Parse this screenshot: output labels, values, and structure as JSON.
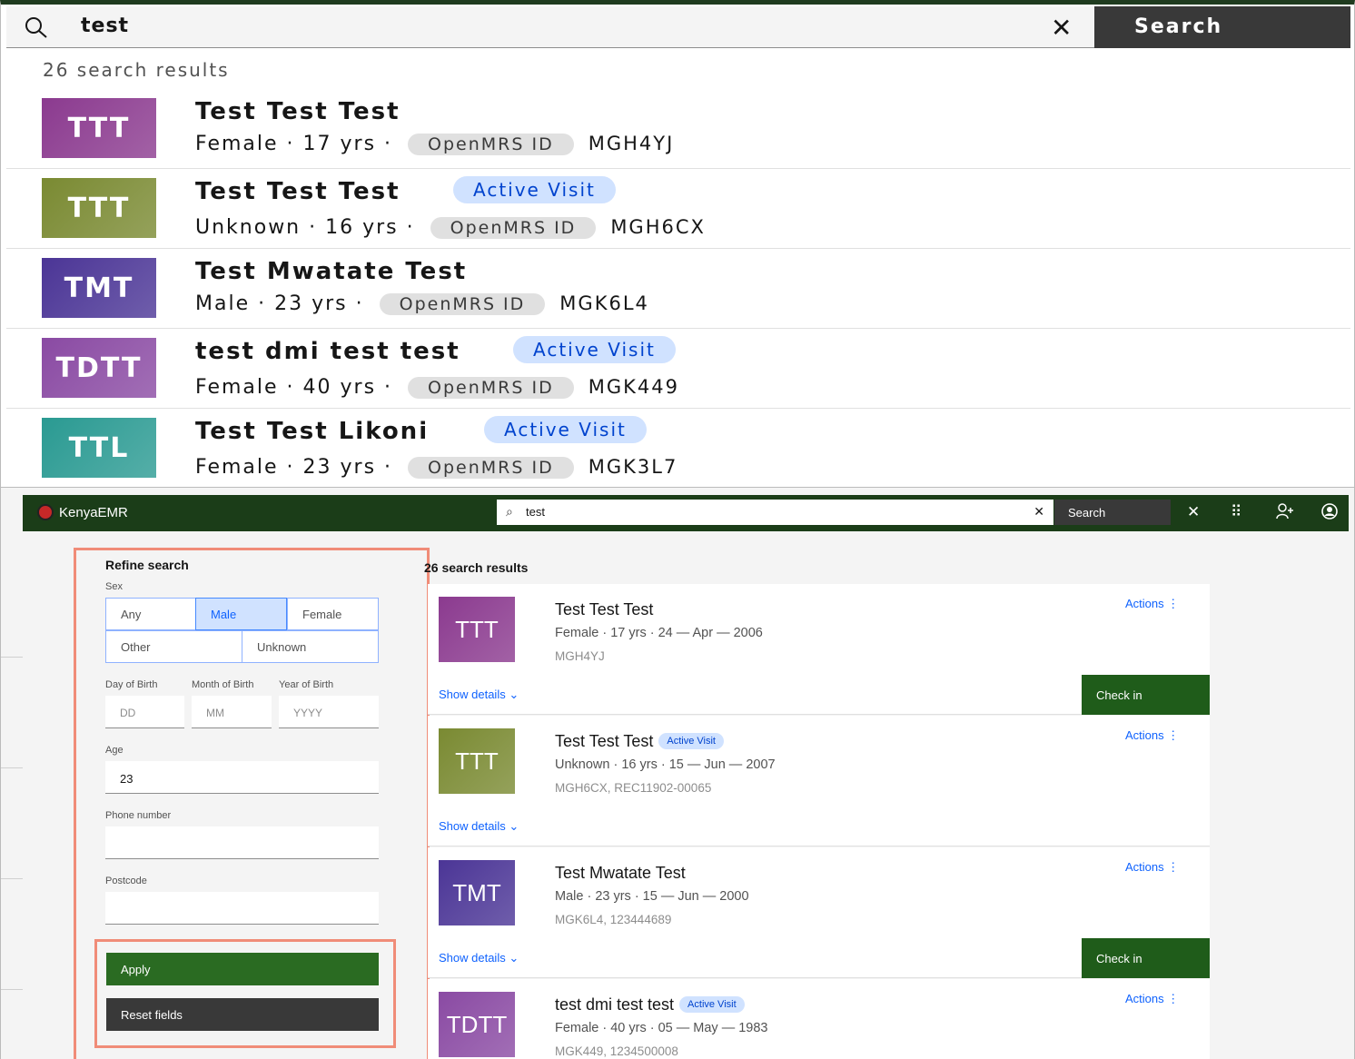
{
  "top": {
    "search": {
      "query": "test",
      "clear_label": "✕",
      "button_label": "Search"
    },
    "result_count": "26 search results",
    "tag_label": "OpenMRS ID",
    "results": [
      {
        "initials": "TTT",
        "name": "Test Test Test",
        "badge": "",
        "sex": "Female",
        "age": "17 yrs",
        "id": "MGH4YJ",
        "color": "#8b3a8f"
      },
      {
        "initials": "TTT",
        "name": "Test Test Test",
        "badge": "Active Visit",
        "sex": "Unknown",
        "age": "16 yrs",
        "id": "MGH6CX",
        "color": "#7a8a32"
      },
      {
        "initials": "TMT",
        "name": "Test Mwatate Test",
        "badge": "",
        "sex": "Male",
        "age": "23 yrs",
        "id": "MGK6L4",
        "color": "#4b3596"
      },
      {
        "initials": "TDTT",
        "name": "test dmi test test",
        "badge": "Active Visit",
        "sex": "Female",
        "age": "40 yrs",
        "id": "MGK449",
        "color": "#8a4aa3"
      },
      {
        "initials": "TTL",
        "name": "Test Test Likoni",
        "badge": "Active Visit",
        "sex": "Female",
        "age": "23 yrs",
        "id": "MGK3L7",
        "color": "#2a9a92"
      }
    ]
  },
  "app": {
    "brand": "KenyaEMR",
    "search": {
      "query": "test",
      "button_label": "Search"
    },
    "refine": {
      "title": "Refine search",
      "sex_label": "Sex",
      "sex_options": [
        "Any",
        "Male",
        "Female",
        "Other",
        "Unknown"
      ],
      "sex_selected": "Male",
      "day_label": "Day of Birth",
      "month_label": "Month of Birth",
      "year_label": "Year of Birth",
      "day_placeholder": "DD",
      "month_placeholder": "MM",
      "year_placeholder": "YYYY",
      "age_label": "Age",
      "age_value": "23",
      "phone_label": "Phone number",
      "postcode_label": "Postcode",
      "apply_label": "Apply",
      "reset_label": "Reset fields"
    },
    "result_count": "26 search results",
    "actions_label": "Actions",
    "show_details_label": "Show details",
    "check_in_label": "Check in",
    "cards": [
      {
        "initials": "TTT",
        "name": "Test Test Test",
        "badge": "",
        "meta": "Female · 17 yrs · 24 — Apr — 2006",
        "ids": "MGH4YJ",
        "check_in": true,
        "color": "#8b3a8f"
      },
      {
        "initials": "TTT",
        "name": "Test Test Test",
        "badge": "Active Visit",
        "meta": "Unknown · 16 yrs · 15 — Jun — 2007",
        "ids": "MGH6CX, REC11902-00065",
        "check_in": false,
        "color": "#7a8a32"
      },
      {
        "initials": "TMT",
        "name": "Test Mwatate Test",
        "badge": "",
        "meta": "Male · 23 yrs · 15 — Jun — 2000",
        "ids": "MGK6L4, 123444689",
        "check_in": true,
        "color": "#4b3596"
      },
      {
        "initials": "TDTT",
        "name": "test dmi test test",
        "badge": "Active Visit",
        "meta": "Female · 40 yrs · 05 — May — 1983",
        "ids": "MGK449, 1234500008",
        "check_in": false,
        "color": "#8a4aa3"
      }
    ]
  }
}
